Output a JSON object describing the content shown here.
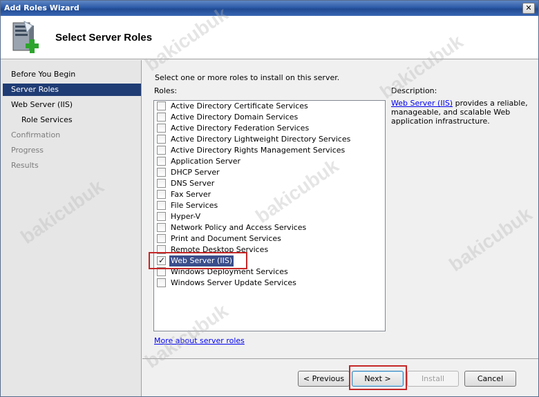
{
  "window": {
    "title": "Add Roles Wizard",
    "close_glyph": "✕"
  },
  "header": {
    "title": "Select Server Roles",
    "icon": "server-add-icon"
  },
  "sidebar": {
    "items": [
      {
        "label": "Before You Begin",
        "state": "normal"
      },
      {
        "label": "Server Roles",
        "state": "active"
      },
      {
        "label": "Web Server (IIS)",
        "state": "normal"
      },
      {
        "label": "Role Services",
        "state": "normal"
      },
      {
        "label": "Confirmation",
        "state": "disabled"
      },
      {
        "label": "Progress",
        "state": "disabled"
      },
      {
        "label": "Results",
        "state": "disabled"
      }
    ]
  },
  "main": {
    "instruction": "Select one or more roles to install on this server.",
    "roles_label": "Roles:",
    "roles": [
      {
        "label": "Active Directory Certificate Services",
        "checked": false
      },
      {
        "label": "Active Directory Domain Services",
        "checked": false
      },
      {
        "label": "Active Directory Federation Services",
        "checked": false
      },
      {
        "label": "Active Directory Lightweight Directory Services",
        "checked": false
      },
      {
        "label": "Active Directory Rights Management Services",
        "checked": false
      },
      {
        "label": "Application Server",
        "checked": false
      },
      {
        "label": "DHCP Server",
        "checked": false
      },
      {
        "label": "DNS Server",
        "checked": false
      },
      {
        "label": "Fax Server",
        "checked": false
      },
      {
        "label": "File Services",
        "checked": false
      },
      {
        "label": "Hyper-V",
        "checked": false
      },
      {
        "label": "Network Policy and Access Services",
        "checked": false
      },
      {
        "label": "Print and Document Services",
        "checked": false
      },
      {
        "label": "Remote Desktop Services",
        "checked": false
      },
      {
        "label": "Web Server (IIS)",
        "checked": true
      },
      {
        "label": "Windows Deployment Services",
        "checked": false
      },
      {
        "label": "Windows Server Update Services",
        "checked": false
      }
    ],
    "description_label": "Description:",
    "description_link": "Web Server (IIS)",
    "description_text": " provides a reliable, manageable, and scalable Web application infrastructure.",
    "more_link": "More about server roles"
  },
  "buttons": {
    "previous": "< Previous",
    "next": "Next >",
    "install": "Install",
    "cancel": "Cancel"
  },
  "watermark": "bakicubuk",
  "colors": {
    "active_nav": "#1f3c74",
    "highlight": "#c52626",
    "link": "#0000ee"
  }
}
